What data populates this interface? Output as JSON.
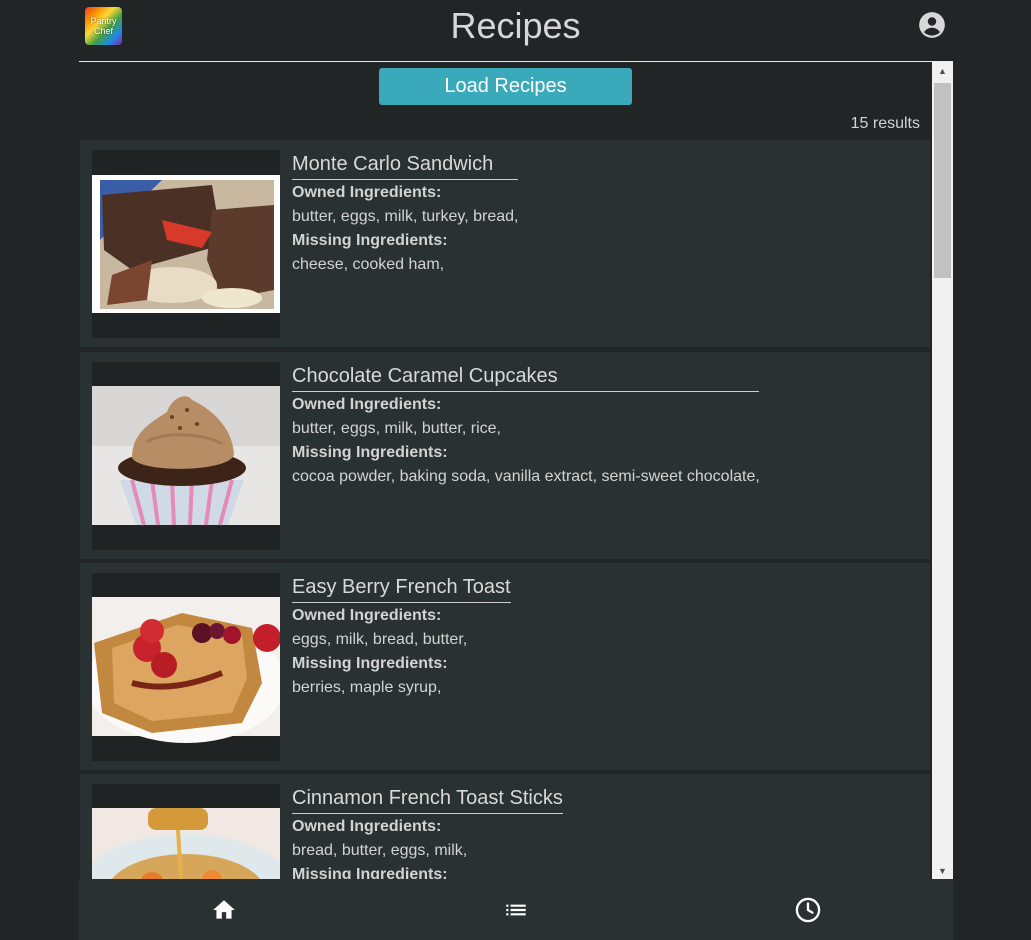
{
  "app": {
    "logo_text_line1": "Pantry",
    "logo_text_line2": "Chef",
    "title": "Recipes",
    "account_icon": "account-circle-icon"
  },
  "main": {
    "load_button_label": "Load Recipes",
    "results_count": "15 results",
    "owned_label": "Owned Ingredients:",
    "missing_label": "Missing Ingredients:",
    "recipes": [
      {
        "title": "Monte Carlo Sandwich",
        "owned": "butter, eggs, milk, turkey, bread,",
        "missing": "cheese, cooked ham,"
      },
      {
        "title": "Chocolate Caramel Cupcakes",
        "owned": "butter, eggs, milk, butter, rice,",
        "missing": "cocoa powder, baking soda, vanilla extract, semi-sweet chocolate,"
      },
      {
        "title": "Easy Berry French Toast",
        "owned": "eggs, milk, bread, butter,",
        "missing": "berries, maple syrup,"
      },
      {
        "title": "Cinnamon French Toast Sticks",
        "owned": "bread, butter, eggs, milk,",
        "missing": ""
      }
    ]
  },
  "bottom_nav": {
    "items": [
      "home-icon",
      "list-icon",
      "clock-icon"
    ]
  },
  "colors": {
    "background": "#212526",
    "card": "#2a3132",
    "accent": "#3aa9b9"
  }
}
